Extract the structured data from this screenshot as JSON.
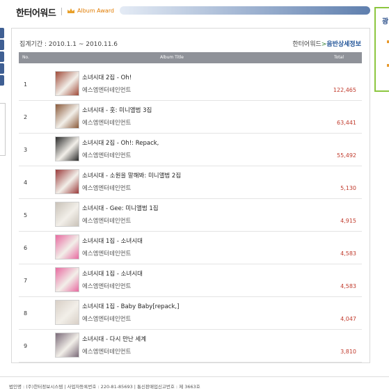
{
  "header": {
    "title": "한터어워드",
    "subtitle": "Album Award"
  },
  "panel": {
    "period": "집계기간 : 2010.1.1 ~ 2010.11.6",
    "detail_prefix": "한터어워드",
    "detail_arrow": ">",
    "detail_link": "음반상세정보"
  },
  "table": {
    "columns": [
      "No.",
      "Album Title",
      "Total"
    ],
    "rows": [
      {
        "rank": "1",
        "title": "소녀시대 2집 - Oh!",
        "label": "에스엠엔터테인먼트",
        "total": "122,465",
        "cover": "#a04a38"
      },
      {
        "rank": "2",
        "title": "소녀시대 - 훗: 미니앨범 3집",
        "label": "에스엠엔터테인먼트",
        "total": "63,441",
        "cover": "#8a5a3a"
      },
      {
        "rank": "3",
        "title": "소녀시대 2집 - Oh!: Repack,",
        "label": "에스엠엔터테인먼트",
        "total": "55,492",
        "cover": "#2a2a2a"
      },
      {
        "rank": "4",
        "title": "소녀시대 - 소원을 말해봐: 미니앨범 2집",
        "label": "에스엠엔터테인먼트",
        "total": "5,130",
        "cover": "#9a3a3a"
      },
      {
        "rank": "5",
        "title": "소녀시대 - Gee: 미니앨범 1집",
        "label": "에스엠엔터테인먼트",
        "total": "4,915",
        "cover": "#c9c2b8"
      },
      {
        "rank": "6",
        "title": "소녀시대 1집 - 소녀시대",
        "label": "에스엠엔터테인먼트",
        "total": "4,583",
        "cover": "#e86aa0"
      },
      {
        "rank": "7",
        "title": "소녀시대 1집 - 소녀시대",
        "label": "에스엠엔터테인먼트",
        "total": "4,583",
        "cover": "#e86aa0"
      },
      {
        "rank": "8",
        "title": "소녀시대 1집 - Baby Baby[repack,]",
        "label": "에스엠엔터테인먼트",
        "total": "4,047",
        "cover": "#d8cfc6"
      },
      {
        "rank": "9",
        "title": "소녀시대 - 다시 만난 세계",
        "label": "에스엠엔터테인먼트",
        "total": "3,810",
        "cover": "#7a6a78"
      }
    ]
  },
  "ad": {
    "title": "광"
  },
  "footer": {
    "line1": "법인명 : (주)한터정보시스템 | 사업자등록번호 : 220-81-85693 | 통신판매업신고번호 : 제 3663호",
    "line2": ""
  },
  "colors": {
    "accent_blue": "#2b4f8a",
    "total_red": "#c0392b",
    "award_orange": "#e07b00",
    "ad_border": "#8cc63f"
  }
}
